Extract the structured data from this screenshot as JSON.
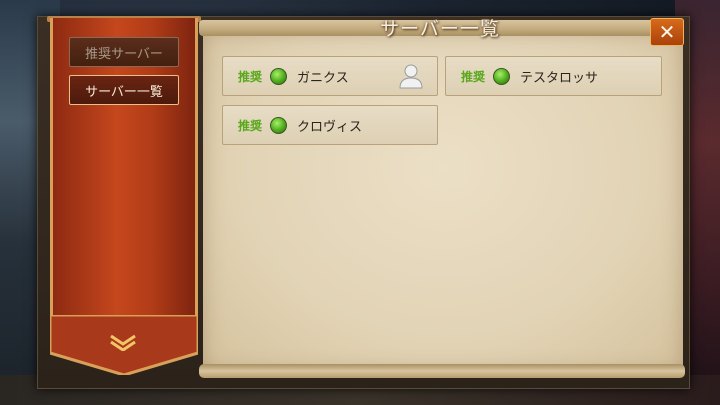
{
  "window": {
    "title": "サーバー一覧"
  },
  "sidebar": {
    "tabs": [
      {
        "label": "推奨サーバー",
        "active": false
      },
      {
        "label": "サーバー一覧",
        "active": true
      }
    ]
  },
  "servers": [
    {
      "tag": "推奨",
      "name": "ガニクス",
      "status": "online",
      "has_character": true
    },
    {
      "tag": "推奨",
      "name": "テスタロッサ",
      "status": "online",
      "has_character": false
    },
    {
      "tag": "推奨",
      "name": "クロヴィス",
      "status": "online",
      "has_character": false
    }
  ],
  "icons": {
    "close": "close-icon",
    "expand": "chevron-down-icon",
    "status": "status-dot-icon",
    "character": "user-avatar-icon"
  },
  "colors": {
    "banner": "#c5471d",
    "recommended_tag": "#5aa81c",
    "online": "#4faa1d",
    "close_button": "#d86a1c"
  }
}
